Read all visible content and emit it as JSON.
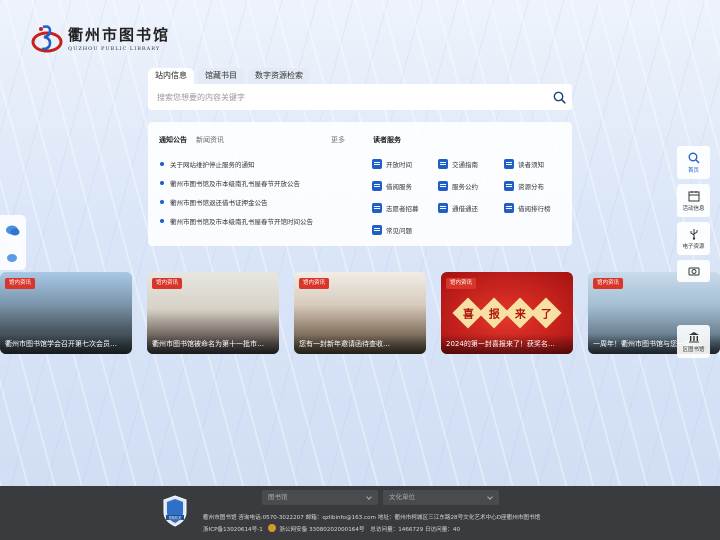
{
  "logo": {
    "name": "衢州市图书馆",
    "english": "QUZHOU PUBLIC LIBRARY"
  },
  "search": {
    "tabs": [
      "站内信息",
      "馆藏书目",
      "数字资源检索"
    ],
    "active_tab": 0,
    "placeholder": "搜索您想要的内容关键字",
    "icon": "search-icon"
  },
  "notices": {
    "tabs": [
      "通知公告",
      "新闻资讯"
    ],
    "more": "更多",
    "items": [
      "关于网站维护停止服务的通知",
      "衢州市图书馆及市本级南孔书屋春节开放公告",
      "衢州市图书馆退还借书证押金公告",
      "衢州市图书馆及市本级南孔书屋春节开馆时间公告"
    ]
  },
  "services": {
    "title": "读者服务",
    "items": [
      "开放时间",
      "交通指南",
      "读者须知",
      "借阅服务",
      "服务公约",
      "资源分布",
      "志愿者招募",
      "通借通还",
      "借阅排行榜",
      "常见问题"
    ]
  },
  "side_nav": {
    "items": [
      {
        "label": "首页",
        "icon": "search-icon"
      },
      {
        "label": "活动信息",
        "icon": "calendar-icon"
      },
      {
        "label": "电子资源",
        "icon": "usb-icon"
      },
      {
        "label": "",
        "icon": "camera-icon"
      },
      {
        "label": "区图书馆",
        "icon": "library-building-icon"
      }
    ]
  },
  "left_float": {
    "icons": [
      "chat-icon",
      "wechat-icon"
    ]
  },
  "news": [
    {
      "badge": "馆内资讯",
      "caption": "衢州市图书馆学会召开第七次会员…"
    },
    {
      "badge": "馆内资讯",
      "caption": "衢州市图书馆被命名为第十一批市…"
    },
    {
      "badge": "馆内资讯",
      "caption": "您有一封新年邀请函待查收…"
    },
    {
      "badge": "馆内资讯",
      "caption": "2024的第一封喜报来了！获奖名…",
      "banner": [
        "喜",
        "报",
        "来",
        "了"
      ]
    },
    {
      "badge": "馆内资讯",
      "caption": "一周年！衢州市图书馆与您一路同…"
    }
  ],
  "footer": {
    "selects": [
      "图书馆",
      "文化单位"
    ],
    "line1": "衢州市图书馆  咨询电话:0570-3022207  邮箱：qzlibinfo@163.com  地址：衢州市柯城区三江东路28号文化艺术中心D座衢州市图书馆",
    "icp": "浙ICP备13020614号-1",
    "police": "浙公网安备 33080202000164号",
    "visits": "总访问量：1466729  日访问量：40",
    "badge_text": "党政机关"
  },
  "colors": {
    "accent": "#1f5fc9",
    "badge_red": "#d9362b",
    "footer_bg": "#3a3b3e"
  }
}
